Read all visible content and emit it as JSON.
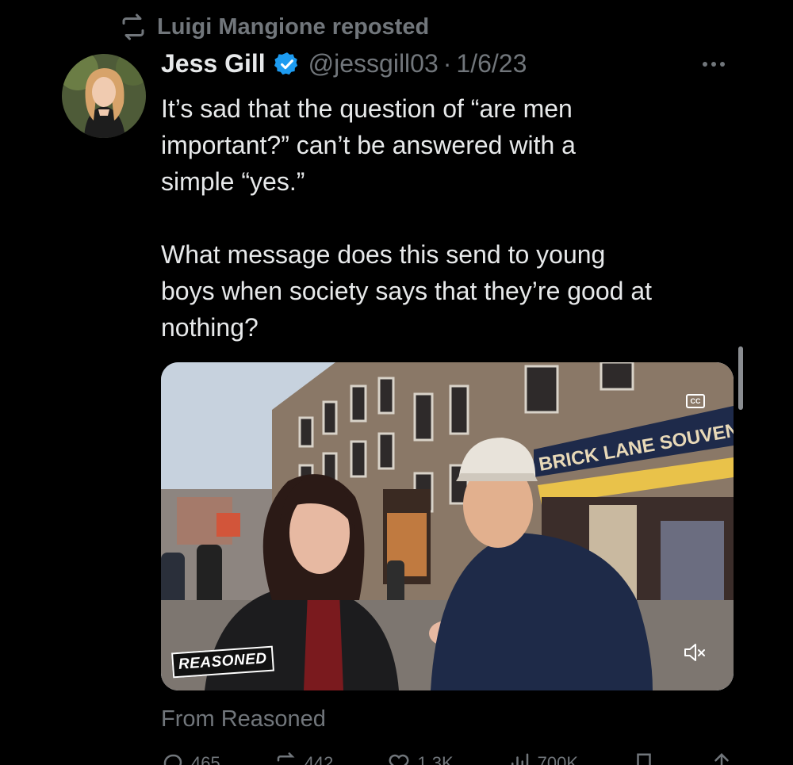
{
  "repost": {
    "text": "Luigi Mangione reposted",
    "icon": "repost-icon"
  },
  "author": {
    "name": "Jess Gill",
    "verified": true,
    "handle": "@jessgill03",
    "separator": "·",
    "date": "1/6/23"
  },
  "tweet": {
    "paragraph1": "It’s sad that the question of “are men\nimportant?” can’t be answered with a\nsimple “yes.”",
    "paragraph2": "What message does this send to young\nboys when society says that they’re good at\nnothing?"
  },
  "media": {
    "shop_sign": "BRICK LANE SOUVENIR",
    "watermark": "REASONED",
    "cc_label": "CC"
  },
  "source": "From Reasoned",
  "actions": {
    "replies": "465",
    "reposts": "442",
    "likes": "1.3K",
    "views": "700K"
  },
  "colors": {
    "background": "#000000",
    "text": "#e7e9ea",
    "muted": "#71767b",
    "verified": "#1d9bf0"
  }
}
